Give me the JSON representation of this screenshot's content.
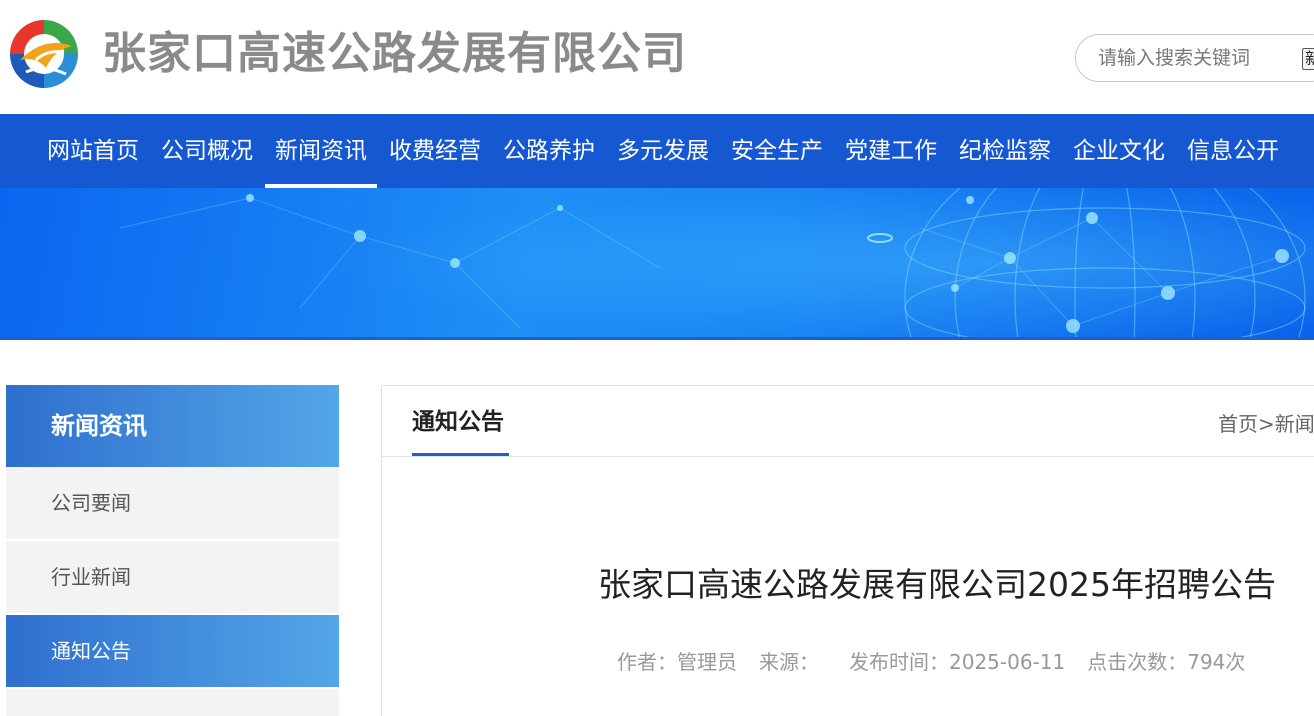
{
  "header": {
    "company_name": "张家口高速公路发展有限公司",
    "logo": "company-logo",
    "search": {
      "placeholder": "请输入搜索关键词",
      "button_label": "新"
    }
  },
  "nav": {
    "items": [
      {
        "label": "网站首页"
      },
      {
        "label": "公司概况"
      },
      {
        "label": "新闻资讯",
        "active": true
      },
      {
        "label": "收费经营"
      },
      {
        "label": "公路养护"
      },
      {
        "label": "多元发展"
      },
      {
        "label": "安全生产"
      },
      {
        "label": "党建工作"
      },
      {
        "label": "纪检监察"
      },
      {
        "label": "企业文化"
      },
      {
        "label": "信息公开"
      }
    ],
    "background_color": "#1658d2"
  },
  "sidebar": {
    "title": "新闻资讯",
    "items": [
      {
        "label": "公司要闻"
      },
      {
        "label": "行业新闻"
      },
      {
        "label": "通知公告",
        "active": true
      }
    ]
  },
  "main": {
    "tab_label": "通知公告",
    "breadcrumb": {
      "home": "首页",
      "separator": ">",
      "current": "新闻资讯"
    },
    "article": {
      "title": "张家口高速公路发展有限公司2025年招聘公告",
      "author_label": "作者：",
      "author": "管理员",
      "source_label": "来源：",
      "source": "",
      "date_label": "发布时间：",
      "date": "2025-06-11",
      "views_label": "点击次数：",
      "views": "794次"
    }
  },
  "colors": {
    "accent": "#1658d2",
    "sidebar_gradient_start": "#2f6fcf",
    "sidebar_gradient_end": "#53a6e8",
    "company_name": "#8a8a8a"
  }
}
